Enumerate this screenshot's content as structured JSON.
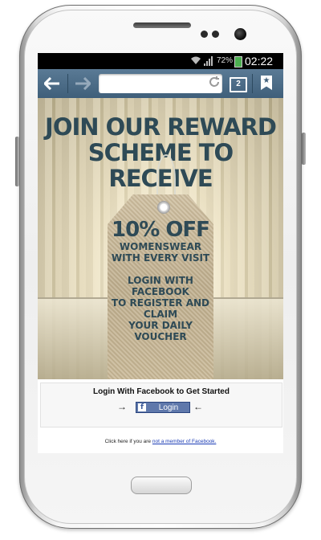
{
  "status_bar": {
    "battery_percent": "72%",
    "time": "02:22",
    "icons": [
      "wifi-icon",
      "signal-icon",
      "battery-icon"
    ]
  },
  "browser": {
    "url_value": "",
    "open_tabs": "2",
    "icons": [
      "back-arrow-icon",
      "forward-arrow-icon",
      "reload-icon",
      "tabs-icon",
      "bookmark-icon"
    ]
  },
  "banner": {
    "headline_line1": "JOIN OUR REWARD",
    "headline_line2": "SCHEME TO RECEIVE",
    "offer": "10% OFF",
    "offer_line1": "WOMENSWEAR",
    "offer_line2": "WITH EVERY VISIT",
    "cta_line1": "LOGIN WITH FACEBOOK",
    "cta_line2": "TO REGISTER AND CLAIM",
    "cta_line3": "YOUR DAILY VOUCHER"
  },
  "login": {
    "title": "Login With Facebook to Get Started",
    "button_label": "Login",
    "fb_letter": "f",
    "arrow_left": "→",
    "arrow_right": "←"
  },
  "footer": {
    "prefix": "Click here if you are",
    "link": "not a member of Facebook."
  },
  "colors": {
    "headline": "#2e4a56",
    "facebook_button": "#5f78ab",
    "url_bar": "#4a6a85"
  }
}
